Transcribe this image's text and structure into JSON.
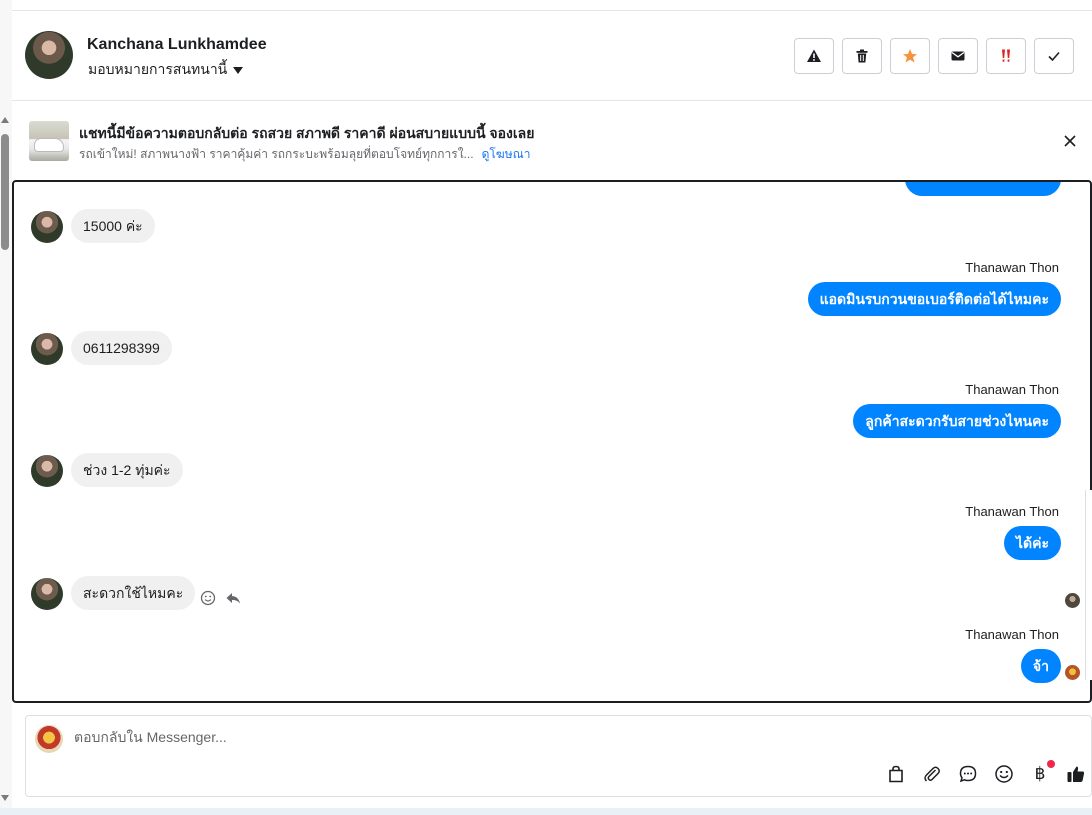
{
  "header": {
    "name": "Kanchana Lunkhamdee",
    "assign_label": "มอบหมายการสนทนานี้",
    "actions": [
      {
        "name": "report-button",
        "icon": "warning-icon"
      },
      {
        "name": "delete-button",
        "icon": "trash-icon"
      },
      {
        "name": "star-button",
        "icon": "star-icon"
      },
      {
        "name": "mail-button",
        "icon": "envelope-icon"
      },
      {
        "name": "spam-button",
        "icon": "double-exclamation-icon"
      },
      {
        "name": "done-button",
        "icon": "check-icon"
      }
    ]
  },
  "ad": {
    "title": "แชทนี้มีข้อความตอบกลับต่อ รถสวย สภาพดี ราคาดี ผ่อนสบายแบบนี้ จองเลย",
    "subtitle": "รถเข้าใหม่! สภาพนางฟ้า ราคาคุ้มค่า รถกระบะพร้อมลุยที่ตอบโจทย์ทุกการใ...",
    "link": "ดูโฆษณา"
  },
  "messages": {
    "m1": "15000 ค่ะ",
    "m2_sender": "Thanawan Thon",
    "m2": "แอดมินรบกวนขอเบอร์ติดต่อได้ไหมคะ",
    "m3": "0611298399",
    "m4_sender": "Thanawan Thon",
    "m4": "ลูกค้าสะดวกรับสายช่วงไหนคะ",
    "m5": "ช่วง 1-2 ทุ่มค่ะ",
    "m6_sender": "Thanawan Thon",
    "m6": "ได้ค่ะ",
    "m7": "สะดวกใช้ไหมคะ",
    "m8_sender": "Thanawan Thon",
    "m8": "จ้า"
  },
  "composer": {
    "placeholder": "ตอบกลับใน Messenger...",
    "currency_symbol": "฿"
  },
  "colors": {
    "outgoing_bubble": "#0084ff",
    "incoming_bubble": "#f0f0f0",
    "star": "#f7923a",
    "spam": "#e02020"
  }
}
